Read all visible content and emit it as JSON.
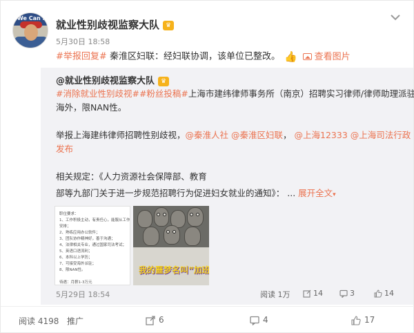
{
  "colors": {
    "accent": "#eb7350",
    "repost_bg": "#f2f2f5",
    "badge": "#f6b21b"
  },
  "post": {
    "author": "就业性别歧视监察大队",
    "avatar_text": "We Can Do It!",
    "verified_badge": "badge-icon",
    "time": "5月30日 18:58",
    "tag": "#举报回复#",
    "text": "秦淮区妇联：经妇联协调，该单位已整改。",
    "emoji": "thumbs-up-icon",
    "view_pictures": "查看图片"
  },
  "repost": {
    "author": "@就业性别歧视监察大队",
    "tags": [
      "#消除就业性别歧视#",
      "#粉丝投稿#"
    ],
    "line1_text": "上海市建纬律师事务所（南京）招聘实习律师/律师助理派驻",
    "line2_text": "海外，限NAN性。",
    "report_prefix": "举报上海建纬律师招聘性别歧视，",
    "mentions": [
      "@秦淮人社",
      "@秦淮区妇联",
      "@上海12333",
      "@上海司法行政"
    ],
    "mention_tail": "发布",
    "rules_line1": "相关规定：《人力资源社会保障部、教育",
    "rules_line2": "部等九部门关于进一步规范招聘行为促进妇女就业的通知》：",
    "ellipsis": "...",
    "expand": "展开全文",
    "image1_lines": [
      "职位要求：",
      "1、工作积极主动，有责任心，能服从工作",
      "安排；",
      "2、熟练应用办公软件；",
      "3、团队协作精神好，善于沟通；",
      "4、法律相关专业，通过国家司法考试；",
      "5、英语口语流利；",
      "6、本科以上学历；",
      "7、可接受海外派驻；",
      "8、限NAN性。",
      "",
      "待遇：月薪1-3万元"
    ],
    "image2_caption": "我的噩梦名叫“加班事件”",
    "time": "5月29日 18:54",
    "stats": {
      "view_label": "阅读",
      "view_count": "1万",
      "reposts": "14",
      "comments": "3",
      "likes": "14"
    }
  },
  "footer": {
    "read_label": "阅读 4198",
    "promote": "推广",
    "reposts": "6",
    "comments": "4",
    "likes": "17"
  }
}
